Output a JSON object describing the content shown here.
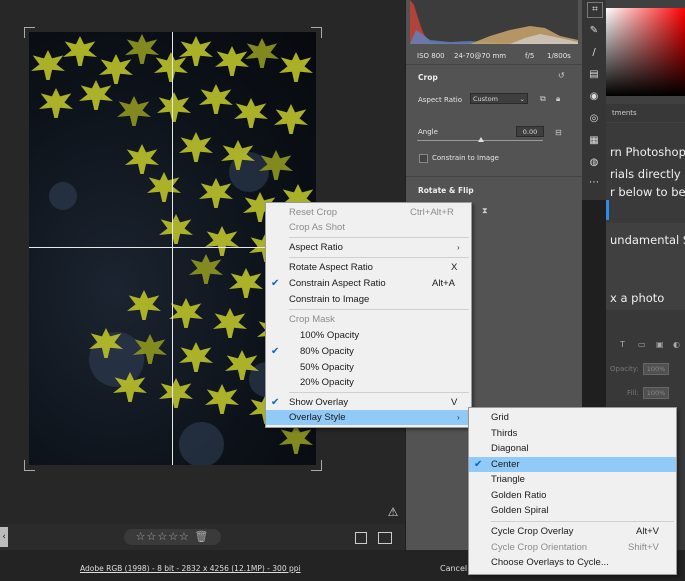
{
  "canvas": {
    "warning_glyph": "⚠",
    "rating_stars": "☆☆☆☆☆",
    "trash_glyph": "🗑"
  },
  "histogram": {
    "iso": "ISO 800",
    "lens": "24-70@70 mm",
    "aperture": "f/5",
    "shutter": "1/800s"
  },
  "crop_panel": {
    "title": "Crop",
    "aspect_ratio_label": "Aspect Ratio",
    "aspect_ratio_value": "Custom",
    "angle_label": "Angle",
    "angle_value": "0.00",
    "constrain_label": "Constrain to Image",
    "rotate_flip_title": "Rotate & Flip"
  },
  "photoshop": {
    "adjustments_tab": "tments",
    "learn_lines": [
      "rn Photoshop",
      "rials directly in",
      "r below to begi",
      "undamental Ski",
      "x a photo"
    ],
    "layer_opacity_label": "Opacity:",
    "layer_opacity_value": "100%",
    "layer_fill_label": "Fill:",
    "layer_fill_value": "100%"
  },
  "status": {
    "color_info": "Adobe RGB (1998) - 8 bit - 2832 x 4256 (12.1MP) - 300 ppi",
    "cancel": "Cancel"
  },
  "context_menu": {
    "items": [
      {
        "label": "Reset Crop",
        "shortcut": "Ctrl+Alt+R",
        "disabled": true
      },
      {
        "label": "Crop As Shot",
        "shortcut": "",
        "disabled": true
      },
      {
        "label": "Aspect Ratio",
        "shortcut": "",
        "submenu": true
      },
      {
        "label": "Rotate Aspect Ratio",
        "shortcut": "X"
      },
      {
        "label": "Constrain Aspect Ratio",
        "shortcut": "Alt+A",
        "checked": true
      },
      {
        "label": "Constrain to Image",
        "shortcut": ""
      },
      {
        "label": "Crop Mask",
        "shortcut": "",
        "disabled": true
      },
      {
        "label": "100% Opacity",
        "shortcut": ""
      },
      {
        "label": "80% Opacity",
        "shortcut": "",
        "checked": true
      },
      {
        "label": "50% Opacity",
        "shortcut": ""
      },
      {
        "label": "20% Opacity",
        "shortcut": ""
      },
      {
        "label": "Show Overlay",
        "shortcut": "V",
        "checked": true
      },
      {
        "label": "Overlay Style",
        "shortcut": "",
        "submenu": true,
        "highlighted": true
      }
    ]
  },
  "overlay_submenu": {
    "items": [
      {
        "label": "Grid",
        "shortcut": ""
      },
      {
        "label": "Thirds",
        "shortcut": ""
      },
      {
        "label": "Diagonal",
        "shortcut": ""
      },
      {
        "label": "Center",
        "shortcut": "",
        "checked": true,
        "highlighted": true
      },
      {
        "label": "Triangle",
        "shortcut": ""
      },
      {
        "label": "Golden Ratio",
        "shortcut": ""
      },
      {
        "label": "Golden Spiral",
        "shortcut": ""
      },
      {
        "label": "Cycle Crop Overlay",
        "shortcut": "Alt+V"
      },
      {
        "label": "Cycle Crop Orientation",
        "shortcut": "Shift+V",
        "disabled": true
      },
      {
        "label": "Choose Overlays to Cycle...",
        "shortcut": ""
      }
    ]
  },
  "colors": {
    "menu_highlight": "#91c9f7",
    "check": "#0a64c8",
    "leaf": "#b8bf2a"
  }
}
